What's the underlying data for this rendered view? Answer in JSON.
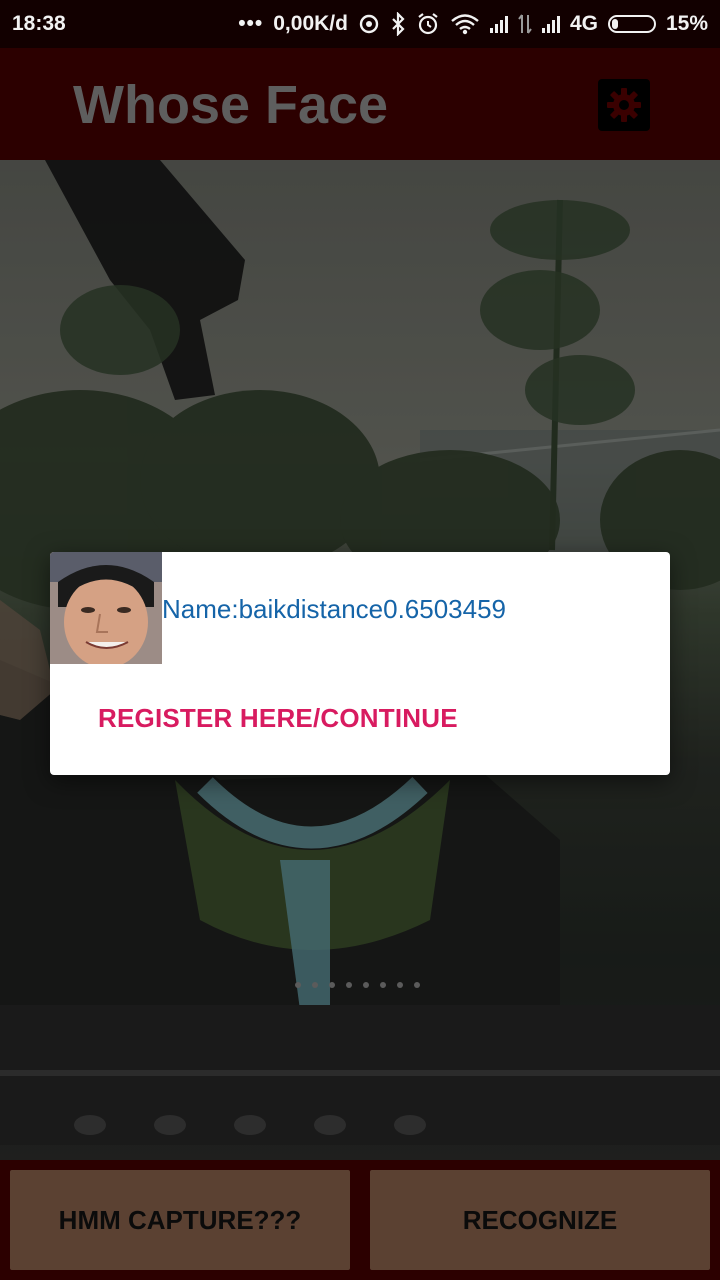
{
  "status_bar": {
    "time": "18:38",
    "dots": "•••",
    "net_speed": "0,00K/d",
    "network_type": "4G",
    "battery": "15%"
  },
  "app_bar": {
    "title": "Whose Face",
    "settings_icon": "gear-icon"
  },
  "dialog": {
    "message": "Name:baikdistance0.6503459",
    "action_label": "REGISTER HERE/CONTINUE"
  },
  "bottom_bar": {
    "capture_label": "HMM CAPTURE???",
    "recognize_label": "RECOGNIZE"
  },
  "colors": {
    "app_bar": "#2c0000",
    "title_text": "#5e5e5e",
    "dialog_text": "#1564a8",
    "dialog_action": "#d81b60",
    "button_bg": "#5b4132"
  }
}
